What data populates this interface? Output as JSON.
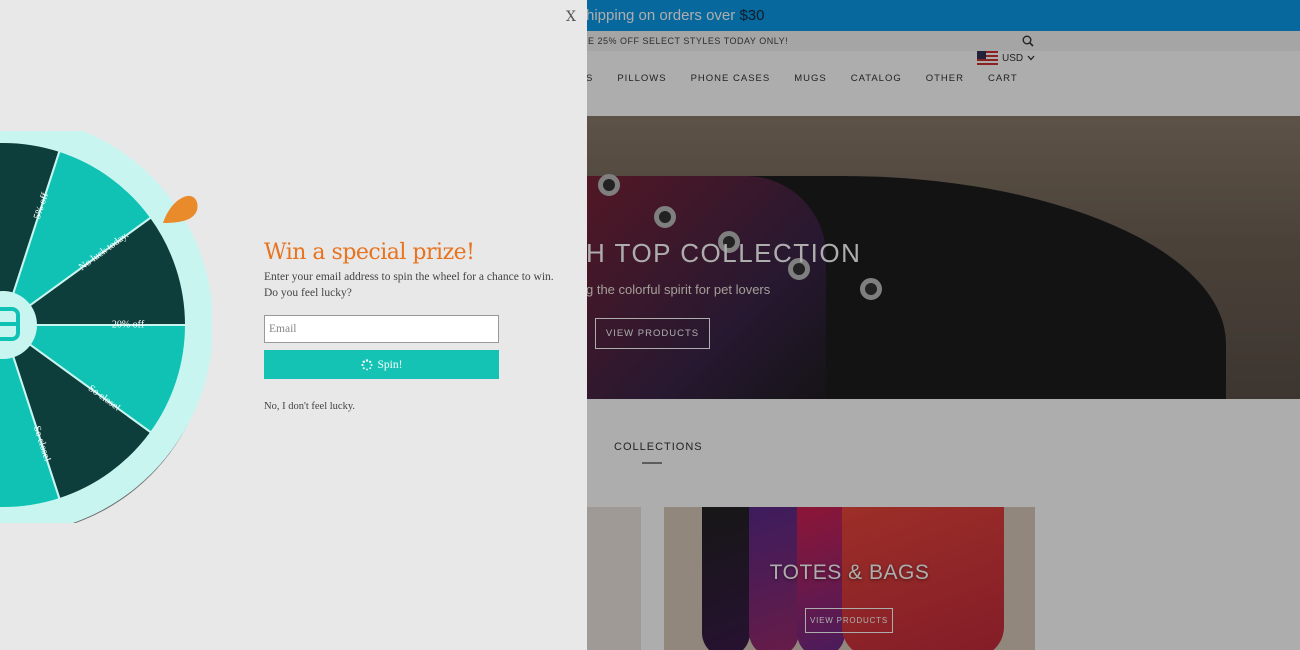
{
  "store": {
    "topbar": {
      "text": "hipping on orders over ",
      "amount": "$30"
    },
    "promo": "E 25% OFF SELECT STYLES TODAY ONLY!",
    "currency": "USD",
    "nav": [
      "S",
      "PILLOWS",
      "PHONE CASES",
      "MUGS",
      "CATALOG",
      "OTHER",
      "CART"
    ],
    "hero": {
      "title": "H TOP COLLECTION",
      "subtitle": "g the colorful spirit for pet lovers",
      "button": "VIEW PRODUCTS"
    },
    "collections_heading": "COLLECTIONS",
    "card": {
      "title": "TOTES & BAGS",
      "button": "VIEW PRODUCTS"
    }
  },
  "popup": {
    "close_label": "X",
    "title": "Win a special prize!",
    "description": "Enter your email address to spin the wheel for a chance to win. Do you feel lucky?",
    "email_placeholder": "Email",
    "spin_label": "Spin!",
    "no_thanks": "No, I don't feel lucky.",
    "wheel": {
      "segments": [
        "5% off",
        "No luck today.",
        "20% off",
        "So close!",
        "So close!"
      ],
      "colors": {
        "light": "#10c2b4",
        "dark": "#0e3e3c",
        "rim": "#c9f5f0",
        "pointer": "#e98b2a"
      }
    }
  },
  "colors": {
    "accent": "#e8731f",
    "button": "#15c3b4",
    "topbar": "#0a9ae8"
  }
}
